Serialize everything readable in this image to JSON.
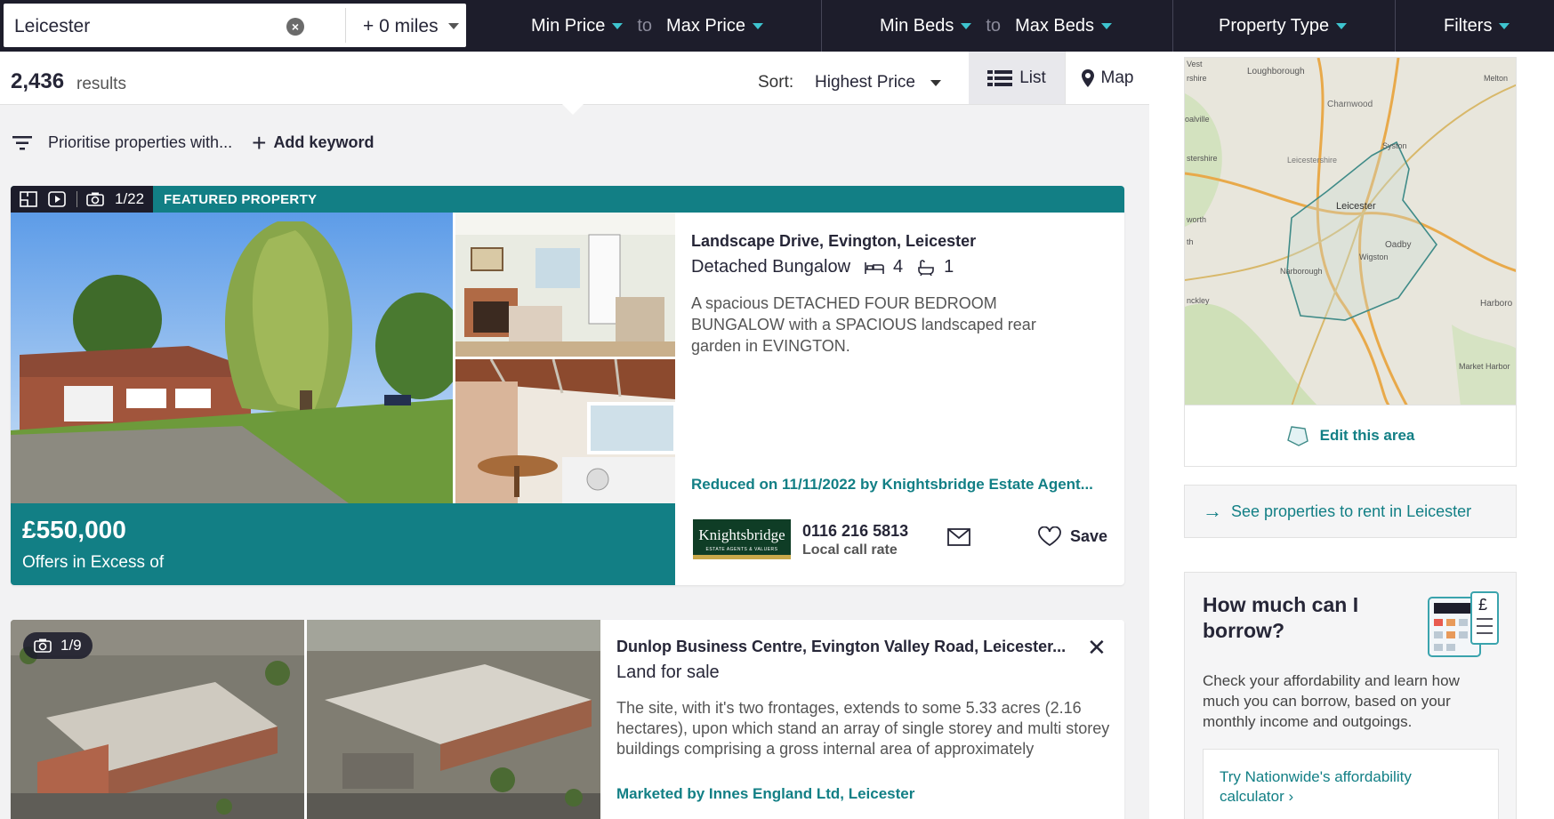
{
  "search": {
    "location": "Leicester",
    "radius": "+ 0 miles"
  },
  "filters": {
    "min_price": "Min Price",
    "max_price": "Max Price",
    "min_beds": "Min Beds",
    "max_beds": "Max Beds",
    "to_label": "to",
    "property_type": "Property Type",
    "filters": "Filters"
  },
  "results": {
    "count": "2,436",
    "label": "results",
    "sort_label": "Sort:",
    "sort_value": "Highest Price",
    "list_label": "List",
    "map_label": "Map"
  },
  "prioritise": {
    "label": "Prioritise properties with...",
    "add_keyword": "Add keyword"
  },
  "listings": [
    {
      "photo_count": "1/22",
      "badge": "FEATURED PROPERTY",
      "price": "£550,000",
      "price_qualifier": "Offers in Excess of",
      "address": "Landscape Drive, Evington, Leicester",
      "property_type": "Detached Bungalow",
      "bedrooms": "4",
      "bathrooms": "1",
      "description": "A spacious DETACHED FOUR BEDROOM BUNGALOW with a SPACIOUS landscaped rear garden in EVINGTON.",
      "reduced": "Reduced on 11/11/2022 by Knightsbridge Estate Agent...",
      "agent_logo_text": "Knightsbridge",
      "agent_logo_sub": "ESTATE AGENTS & VALUERS",
      "phone": "0116 216 5813",
      "phone_note": "Local call rate",
      "save_label": "Save"
    },
    {
      "photo_count": "1/9",
      "address": "Dunlop Business Centre, Evington Valley Road, Leicester...",
      "property_type": "Land for sale",
      "description": "The site, with it's two frontages, extends to some 5.33 acres (2.16 hectares), upon which stand an array of single storey and multi storey buildings comprising a gross internal area of approximately",
      "marketed_by": "Marketed by Innes England Ltd, Leicester"
    }
  ],
  "sidebar": {
    "map_labels": [
      "Vest",
      "rshire",
      "Loughborough",
      "Melton",
      "Charnwood",
      "Syston",
      "oalville",
      "stershire",
      "Leicestershire",
      "Leicester",
      "worth",
      "th",
      "Oadby",
      "Wigston",
      "Narborough",
      "nckley",
      "Harboro",
      "Market Harbor"
    ],
    "edit_area": "Edit this area",
    "rent_link": "See properties to rent in Leicester",
    "borrow_title": "How much can I borrow?",
    "borrow_text": "Check your affordability and learn how much you can borrow, based on your monthly income and outgoings.",
    "borrow_link": "Try Nationwide's affordability calculator ›"
  },
  "colors": {
    "teal": "#127f85",
    "dark": "#1d1d2b",
    "accent_caret": "#3ec4cf"
  }
}
